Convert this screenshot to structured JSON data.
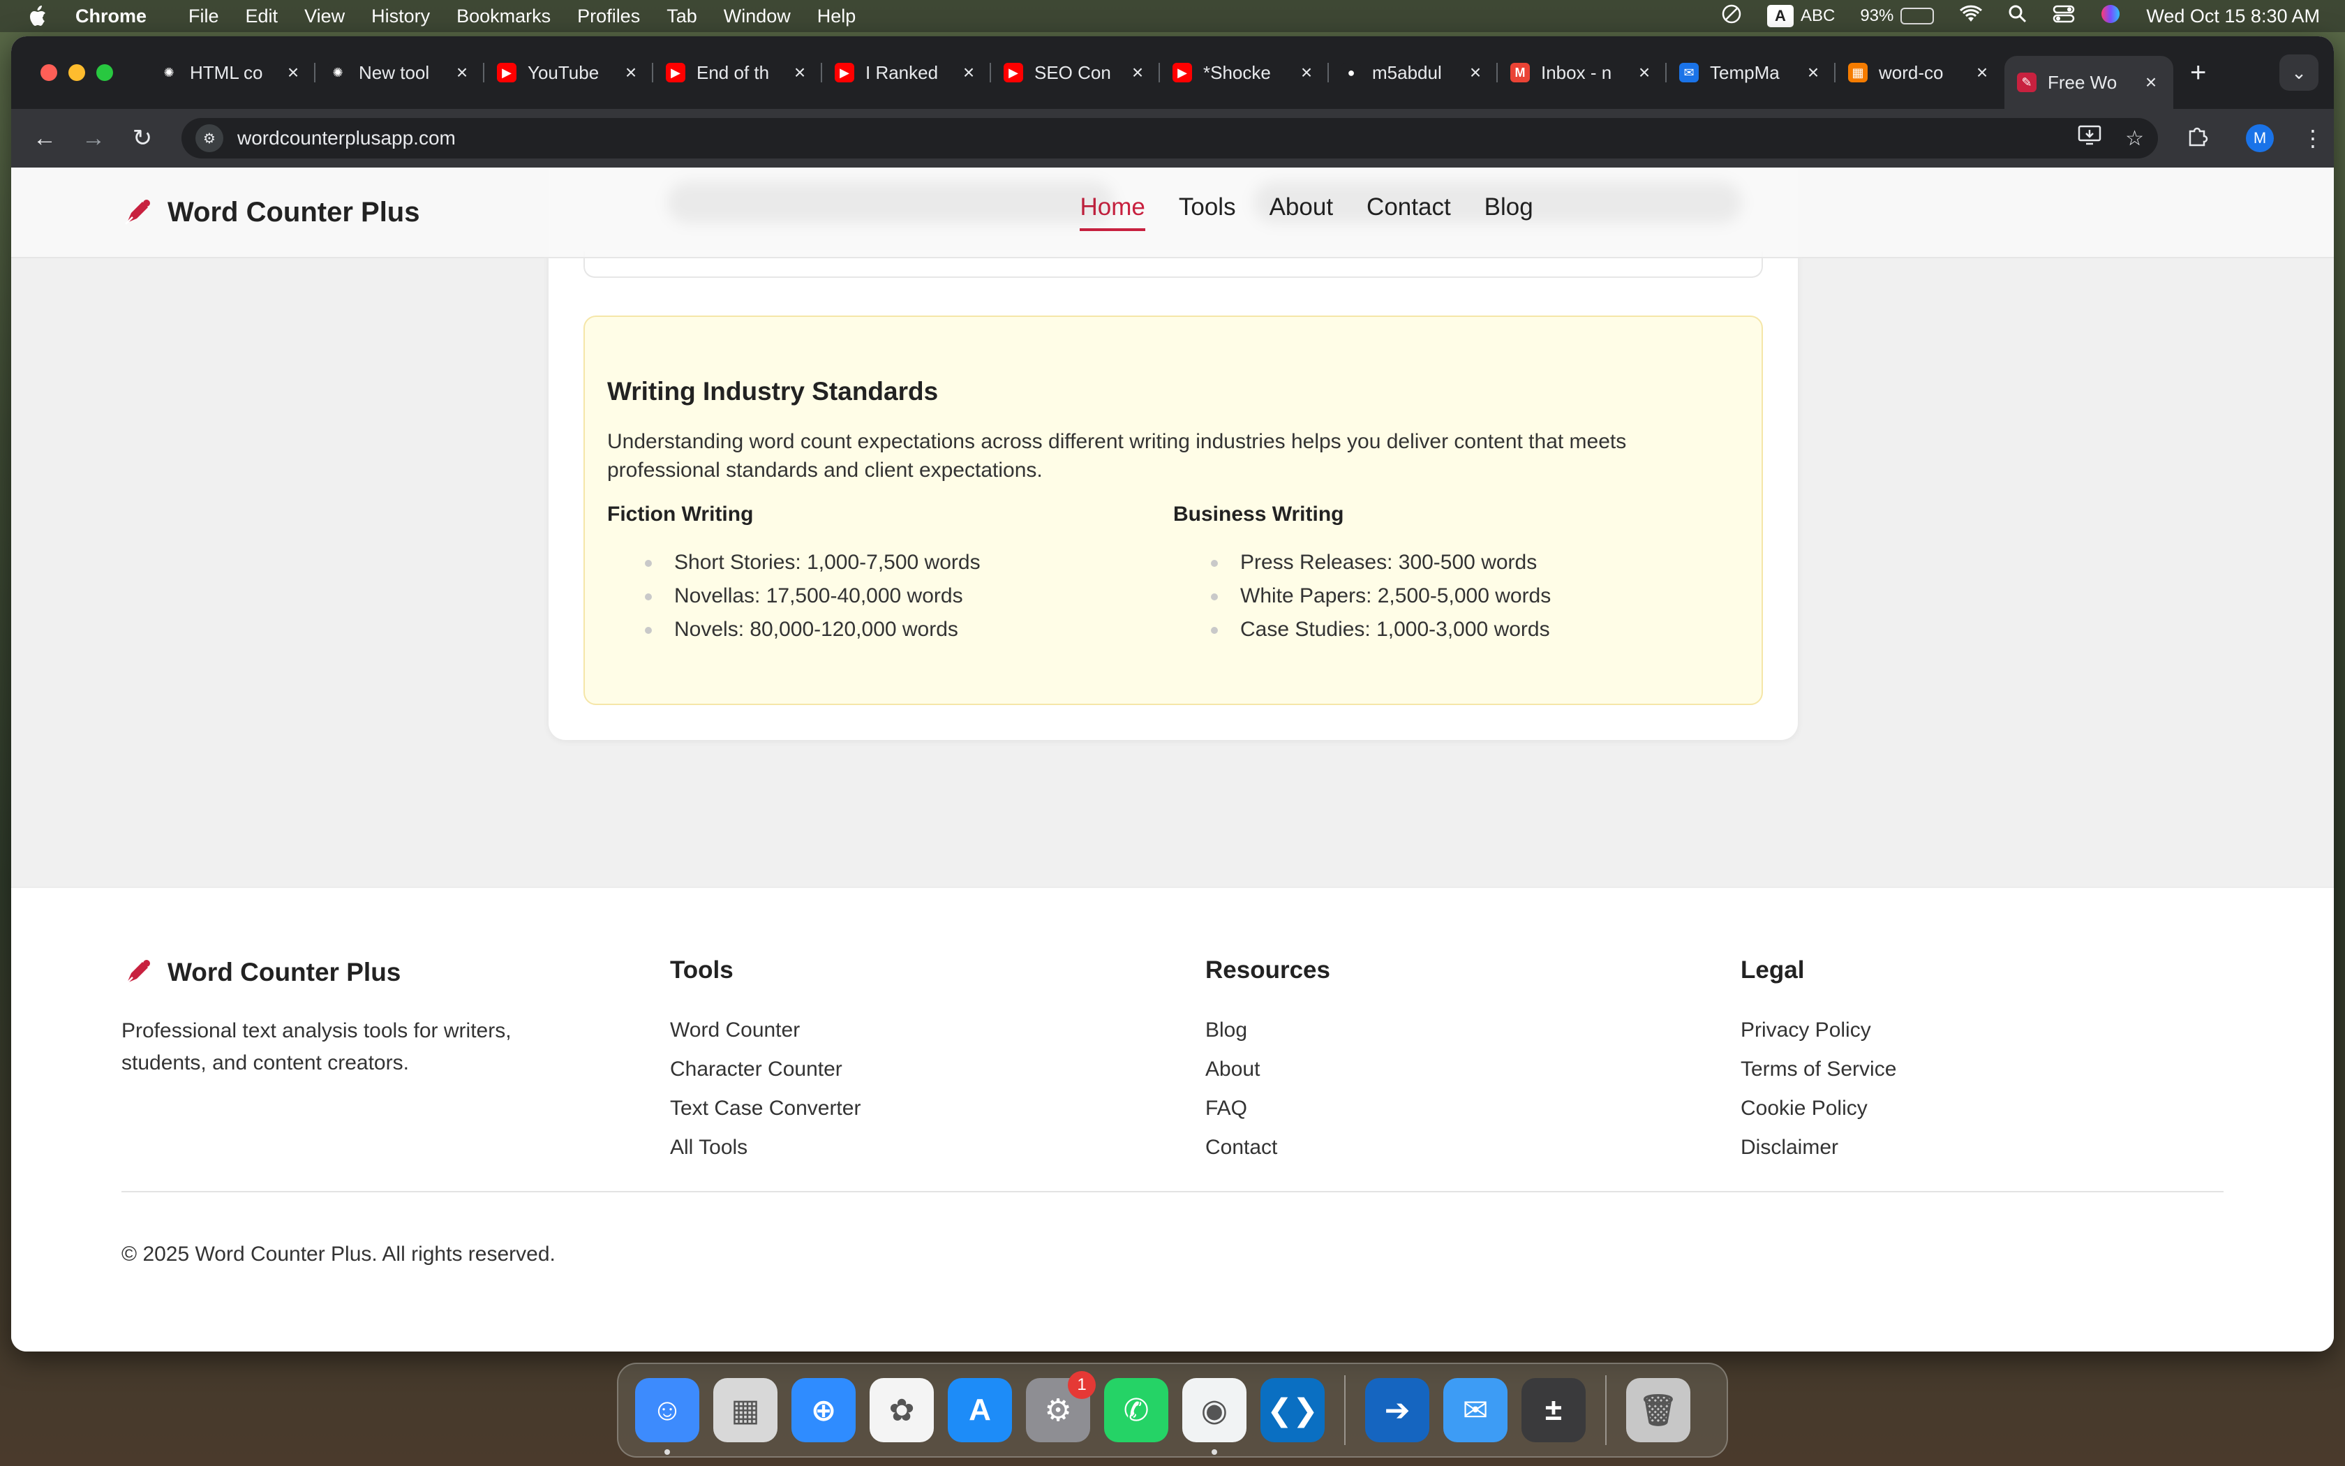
{
  "menubar": {
    "app": "Chrome",
    "items": [
      "File",
      "Edit",
      "View",
      "History",
      "Bookmarks",
      "Profiles",
      "Tab",
      "Window",
      "Help"
    ],
    "input_badge": "A",
    "input_source": "ABC",
    "battery": "93%",
    "battery_level": 0.93,
    "datetime": "Wed Oct 15  8:30 AM"
  },
  "tabs": [
    {
      "title": "HTML co",
      "icon": "openai-icon",
      "color": "#202124"
    },
    {
      "title": "New tool",
      "icon": "openai-icon",
      "color": "#202124"
    },
    {
      "title": "YouTube",
      "icon": "youtube-icon",
      "color": "#ff0000"
    },
    {
      "title": "End of th",
      "icon": "youtube-icon",
      "color": "#ff0000"
    },
    {
      "title": "I Ranked",
      "icon": "youtube-icon",
      "color": "#ff0000"
    },
    {
      "title": "SEO Con",
      "icon": "youtube-icon",
      "color": "#ff0000"
    },
    {
      "title": "*Shocke",
      "icon": "youtube-icon",
      "color": "#ff0000"
    },
    {
      "title": "m5abdul",
      "icon": "github-icon",
      "color": "#202124"
    },
    {
      "title": "Inbox - n",
      "icon": "gmail-icon",
      "color": "#ea4335"
    },
    {
      "title": "TempMa",
      "icon": "tempmail-icon",
      "color": "#1a73e8"
    },
    {
      "title": "word-co",
      "icon": "repo-icon",
      "color": "#f57c00"
    },
    {
      "title": "Free Wo",
      "icon": "pen-icon",
      "color": "#c8213f",
      "active": true
    }
  ],
  "omnibox": {
    "url": "wordcounterplusapp.com"
  },
  "profile_initial": "M",
  "site": {
    "brand": "Word Counter Plus",
    "nav": [
      "Home",
      "Tools",
      "About",
      "Contact",
      "Blog"
    ],
    "active_nav": "Home",
    "accent": "#c8213f"
  },
  "standards": {
    "title": "Writing Industry Standards",
    "intro": "Understanding word count expectations across different writing industries helps you deliver content that meets professional standards and client expectations.",
    "fiction": {
      "title": "Fiction Writing",
      "items": [
        "Short Stories: 1,000-7,500 words",
        "Novellas: 17,500-40,000 words",
        "Novels: 80,000-120,000 words"
      ]
    },
    "business": {
      "title": "Business Writing",
      "items": [
        "Press Releases: 300-500 words",
        "White Papers: 2,500-5,000 words",
        "Case Studies: 1,000-3,000 words"
      ]
    }
  },
  "footer": {
    "brand": "Word Counter Plus",
    "tagline": "Professional text analysis tools for writers, students, and content creators.",
    "tools": {
      "title": "Tools",
      "links": [
        "Word Counter",
        "Character Counter",
        "Text Case Converter",
        "All Tools"
      ]
    },
    "resources": {
      "title": "Resources",
      "links": [
        "Blog",
        "About",
        "FAQ",
        "Contact"
      ]
    },
    "legal": {
      "title": "Legal",
      "links": [
        "Privacy Policy",
        "Terms of Service",
        "Cookie Policy",
        "Disclaimer"
      ]
    },
    "copyright": "© 2025 Word Counter Plus. All rights reserved."
  },
  "dock": {
    "apps": [
      {
        "name": "finder-icon",
        "color": "#3d8bfd",
        "running": true
      },
      {
        "name": "launchpad-icon",
        "color": "#d8d8d8"
      },
      {
        "name": "safari-icon",
        "color": "#2f8cff"
      },
      {
        "name": "photos-icon",
        "color": "#f4f4f4"
      },
      {
        "name": "app-store-icon",
        "color": "#1d8cf8"
      },
      {
        "name": "system-settings-icon",
        "color": "#8e8e93",
        "badge": "1"
      },
      {
        "name": "whatsapp-icon",
        "color": "#25d366"
      },
      {
        "name": "chrome-icon",
        "color": "#f1f3f4",
        "running": true
      },
      {
        "name": "vscode-icon",
        "color": "#0a6fc2"
      },
      {
        "name": "migration-icon",
        "color": "#1565c0"
      },
      {
        "name": "mail-icon",
        "color": "#3d9cf5"
      },
      {
        "name": "calculator-icon",
        "color": "#3a3a3c"
      },
      {
        "name": "trash-icon",
        "color": "#c7c7c7"
      }
    ]
  }
}
